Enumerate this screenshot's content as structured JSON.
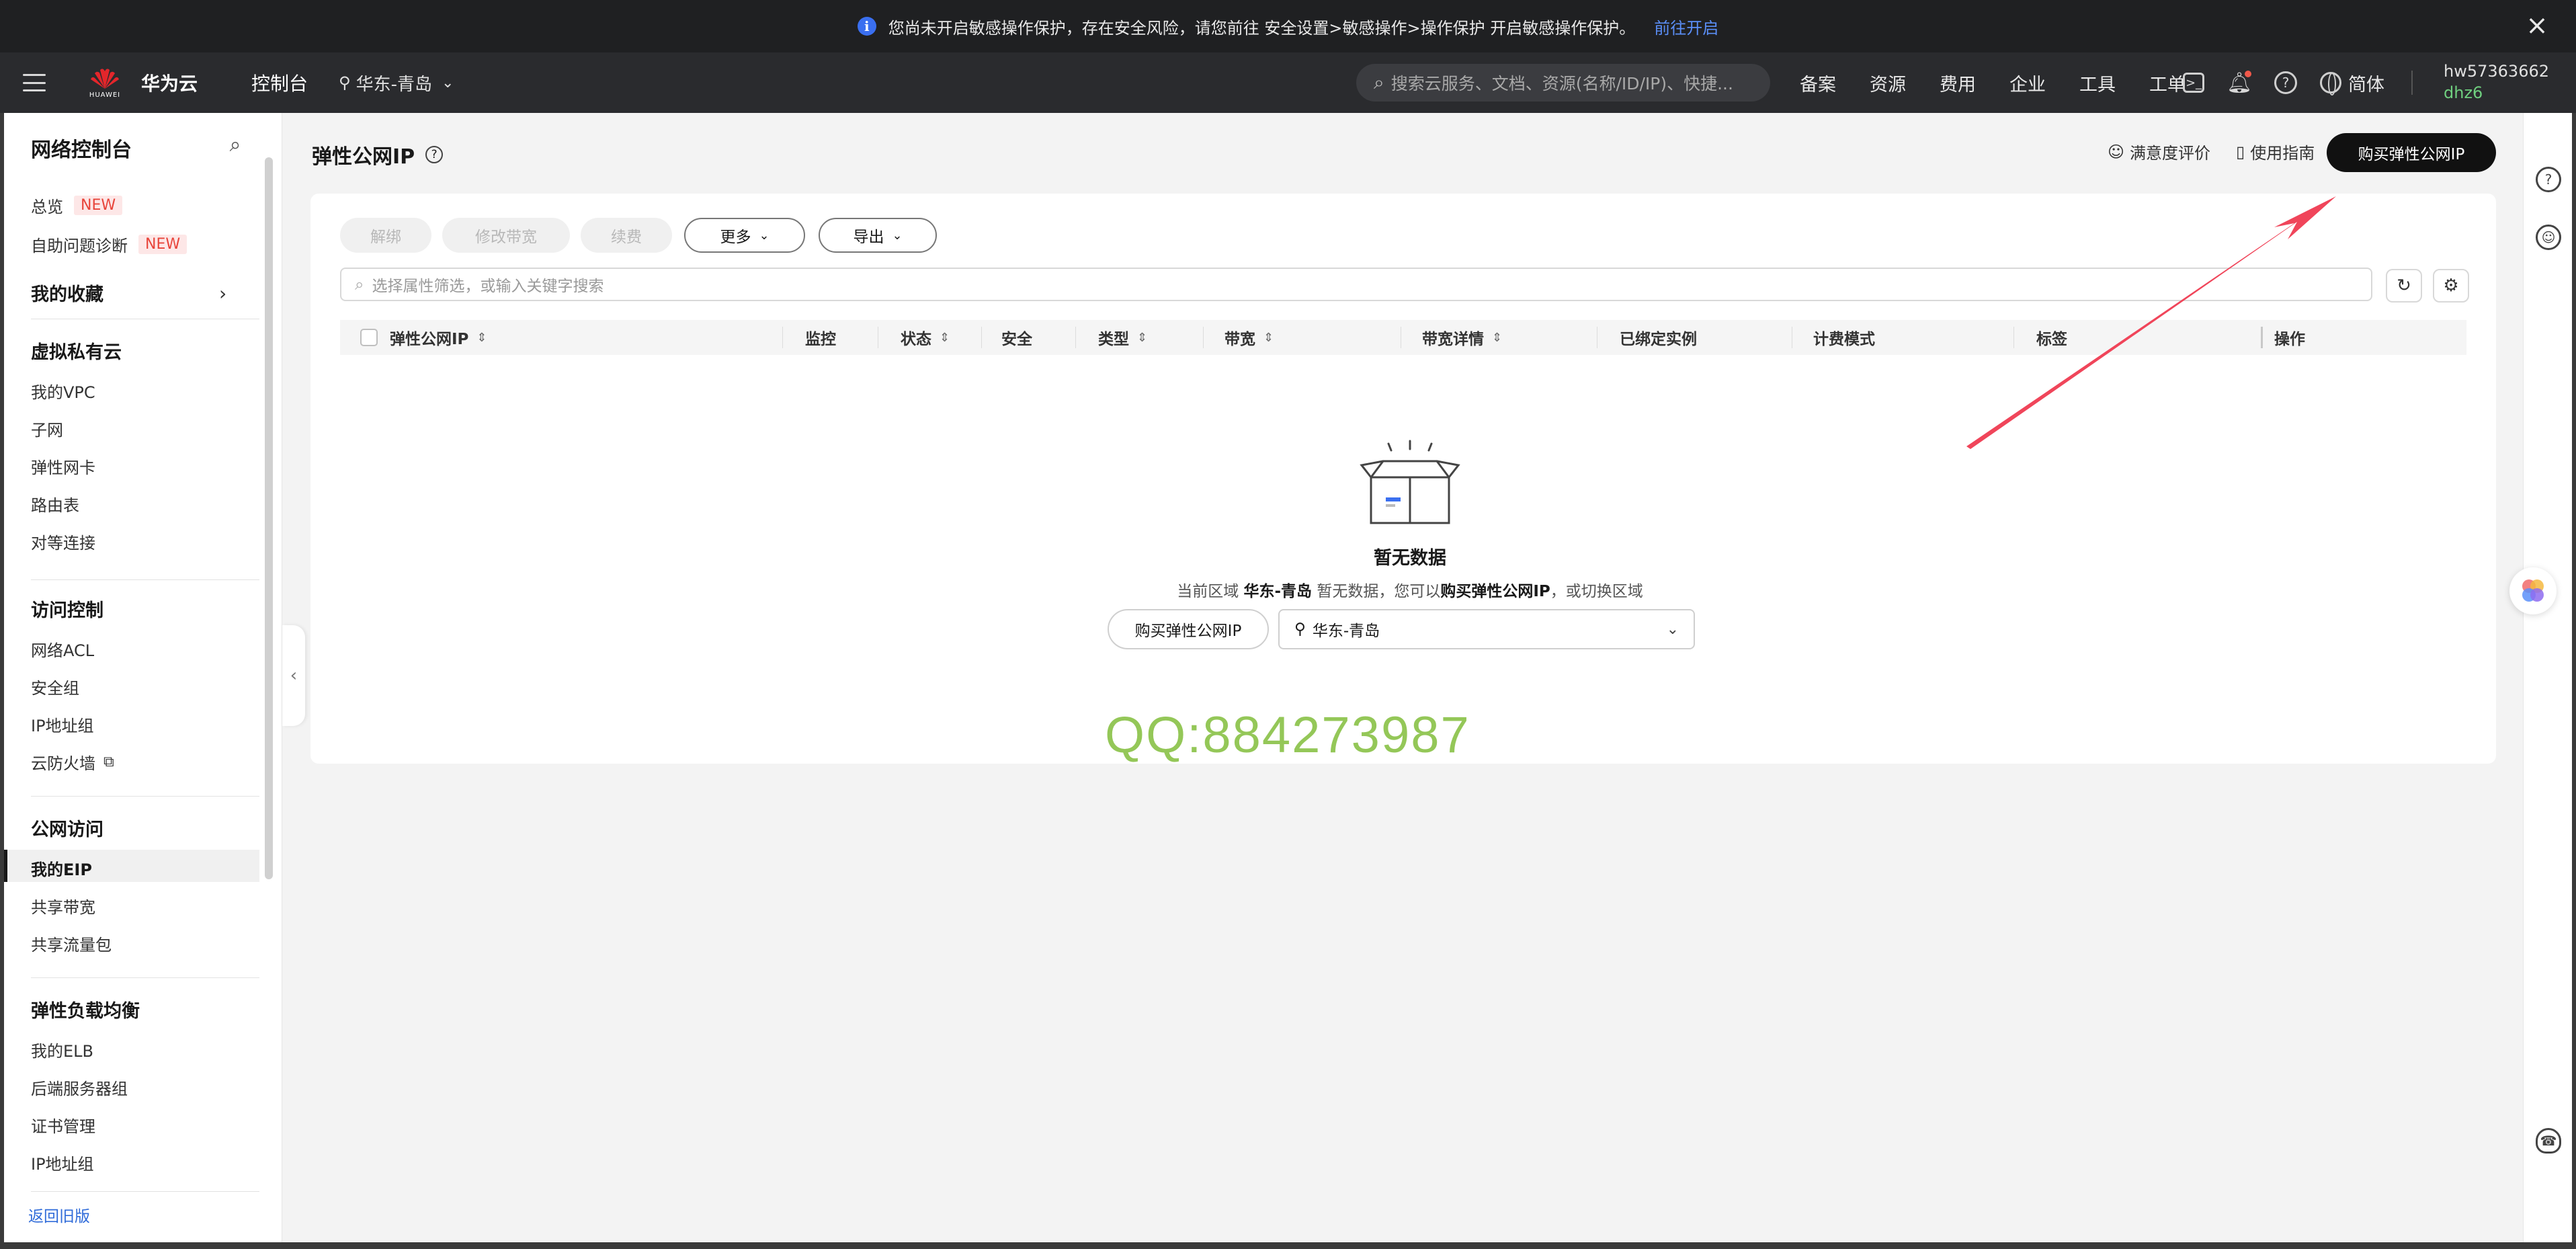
{
  "notice": {
    "text": "您尚未开启敏感操作保护，存在安全风险，请您前往 安全设置>敏感操作>操作保护 开启敏感操作保护。",
    "link": "前往开启"
  },
  "header": {
    "brand": "华为云",
    "logo_text": "HUAWEI",
    "console": "控制台",
    "region": "华东-青岛",
    "search_placeholder": "搜索云服务、文档、资源(名称/ID/IP)、快捷...",
    "nav": [
      "备案",
      "资源",
      "费用",
      "企业",
      "工具",
      "工单"
    ],
    "lang": "简体",
    "account_name": "hw57363662",
    "account_sub": "dhz6"
  },
  "sidebar": {
    "title": "网络控制台",
    "overview": "总览",
    "diagnose": "自助问题诊断",
    "new_badge": "NEW",
    "favorites": "我的收藏",
    "groups": [
      {
        "title": "虚拟私有云",
        "items": [
          "我的VPC",
          "子网",
          "弹性网卡",
          "路由表",
          "对等连接"
        ]
      },
      {
        "title": "访问控制",
        "items": [
          "网络ACL",
          "安全组",
          "IP地址组",
          "云防火墙"
        ]
      },
      {
        "title": "公网访问",
        "items": [
          "我的EIP",
          "共享带宽",
          "共享流量包"
        ]
      },
      {
        "title": "弹性负载均衡",
        "items": [
          "我的ELB",
          "后端服务器组",
          "证书管理",
          "IP地址组"
        ]
      }
    ],
    "back_link": "返回旧版"
  },
  "page": {
    "title": "弹性公网IP",
    "satisfaction": "满意度评价",
    "guide": "使用指南",
    "buy_button": "购买弹性公网IP"
  },
  "toolbar": {
    "unbind": "解绑",
    "modify_bandwidth": "修改带宽",
    "renew": "续费",
    "more": "更多",
    "export": "导出",
    "filter_placeholder": "选择属性筛选，或输入关键字搜索"
  },
  "table": {
    "columns": [
      "弹性公网IP",
      "监控",
      "状态",
      "安全",
      "类型",
      "带宽",
      "带宽详情",
      "已绑定实例",
      "计费模式",
      "标签",
      "操作"
    ]
  },
  "empty": {
    "title": "暂无数据",
    "desc_prefix": "当前区域",
    "desc_region": "华东-青岛",
    "desc_middle": "暂无数据，您可以",
    "desc_link": "购买弹性公网IP",
    "desc_suffix": "，或切换区域",
    "buy_button": "购买弹性公网IP",
    "region_select": "华东-青岛"
  },
  "watermark": "QQ:884273987",
  "colors": {
    "notice_bg": "#1f2022",
    "header_bg": "#2a2b2e",
    "primary_btn": "#111111",
    "link": "#2f6bd9",
    "badge_new": "#e8443a",
    "annotation_arrow": "#f0455a",
    "watermark": "#8bc34a"
  }
}
